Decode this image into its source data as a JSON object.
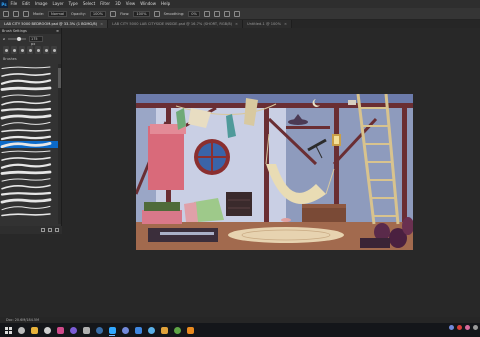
{
  "app": {
    "logo": "Ps"
  },
  "menu": [
    "File",
    "Edit",
    "Image",
    "Layer",
    "Type",
    "Select",
    "Filter",
    "3D",
    "View",
    "Window",
    "Help"
  ],
  "options_bar": {
    "mode_label": "Mode:",
    "mode_value": "Normal",
    "opacity_label": "Opacity:",
    "opacity_value": "100%",
    "flow_label": "Flow:",
    "flow_value": "100%",
    "smoothing_label": "Smoothing:",
    "smoothing_value": "0%"
  },
  "tabs": [
    {
      "label": "LAB CITY 5000 BEDROOM.psd @ 33.3% (1 BGMG/8)",
      "active": true
    },
    {
      "label": "LAB CITY 5000 LAB CITYSIDE INSIDE.psd @ 16.7% (SHORT, RGB/8)",
      "active": false
    },
    {
      "label": "Untitled-1 @ 100%",
      "active": false
    }
  ],
  "brush_panel": {
    "title": "Brush Settings",
    "size_value": "175 px",
    "group_label": "Brushes",
    "selected_index": 11
  },
  "status_bar": {
    "text": "Doc: 20.6M/184.5M"
  },
  "taskbar": {
    "icons": [
      {
        "name": "windows-start-icon",
        "color": "#dcdcdc"
      },
      {
        "name": "search-icon",
        "color": "#bcbcbc"
      },
      {
        "name": "chrome-icon",
        "color": "#e8b23a"
      },
      {
        "name": "obs-icon",
        "color": "#cfcfcf"
      },
      {
        "name": "pink-app-icon",
        "color": "#d04a8a"
      },
      {
        "name": "purple-app-icon",
        "color": "#7b5cd6"
      },
      {
        "name": "music-icon",
        "color": "#b0b0b0"
      },
      {
        "name": "steam-icon",
        "color": "#3a6ea8"
      },
      {
        "name": "photoshop-icon",
        "color": "#31a8ff",
        "active": true
      },
      {
        "name": "discord-icon",
        "color": "#7289da"
      },
      {
        "name": "blue-app-icon",
        "color": "#3f87e0"
      },
      {
        "name": "image-app-icon",
        "color": "#5ab0e8"
      },
      {
        "name": "chrome-icon-2",
        "color": "#e0a23a"
      },
      {
        "name": "green-app-icon",
        "color": "#5fa545"
      },
      {
        "name": "vlc-icon",
        "color": "#e98a1f"
      }
    ],
    "tray": [
      {
        "name": "discord-tray-icon",
        "color": "#7289da"
      },
      {
        "name": "red-tray-icon",
        "color": "#d9403a"
      },
      {
        "name": "pink-tray-icon",
        "color": "#d86a9c"
      },
      {
        "name": "gray-tray-icon",
        "color": "#9a9a9a"
      }
    ]
  },
  "colors": {
    "wall": "#9aa6c6",
    "wall_light": "#c9cfe4",
    "beam": "#6a2e33",
    "floor": "#a26a4e",
    "rug": "#e7d3b0",
    "frame": "#d9d6d6"
  }
}
